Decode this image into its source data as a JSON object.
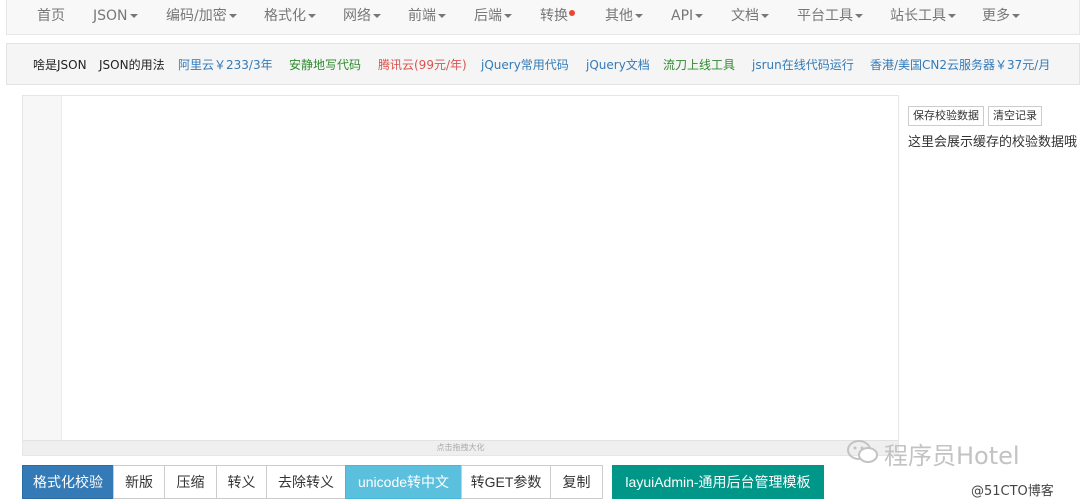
{
  "nav": {
    "items": [
      {
        "label": "首页",
        "dropdown": false
      },
      {
        "label": "JSON",
        "dropdown": true
      },
      {
        "label": "编码/加密",
        "dropdown": true
      },
      {
        "label": "格式化",
        "dropdown": true
      },
      {
        "label": "网络",
        "dropdown": true
      },
      {
        "label": "前端",
        "dropdown": true
      },
      {
        "label": "后端",
        "dropdown": true
      },
      {
        "label": "转换",
        "dropdown": false,
        "dot": true
      },
      {
        "label": "其他",
        "dropdown": true
      },
      {
        "label": "API",
        "dropdown": true
      },
      {
        "label": "文档",
        "dropdown": true
      },
      {
        "label": "平台工具",
        "dropdown": true
      },
      {
        "label": "站长工具",
        "dropdown": true
      },
      {
        "label": "更多",
        "dropdown": true
      }
    ]
  },
  "links": [
    {
      "label": "啥是JSON",
      "color": "#222222"
    },
    {
      "label": "JSON的用法",
      "color": "#222222"
    },
    {
      "label": "阿里云￥233/3年",
      "color": "#337ab7"
    },
    {
      "label": "安静地写代码",
      "color": "#2e8b2e"
    },
    {
      "label": "腾讯云(99元/年)",
      "color": "#d9534f"
    },
    {
      "label": "jQuery常用代码",
      "color": "#337ab7"
    },
    {
      "label": "jQuery文档",
      "color": "#337ab7"
    },
    {
      "label": "流刀上线工具",
      "color": "#2e8b2e"
    },
    {
      "label": "jsrun在线代码运行",
      "color": "#337ab7"
    },
    {
      "label": "香港/美国CN2云服务器￥37元/月",
      "color": "#337ab7"
    }
  ],
  "editor": {
    "resize_hint": "点击拖拽大化"
  },
  "side": {
    "save_label": "保存校验数据",
    "clear_label": "清空记录",
    "cache_text": "这里会展示缓存的校验数据哦"
  },
  "toolbar": {
    "buttons": [
      {
        "label": "格式化校验",
        "style": "primary"
      },
      {
        "label": "新版",
        "style": "default"
      },
      {
        "label": "压缩",
        "style": "default"
      },
      {
        "label": "转义",
        "style": "default"
      },
      {
        "label": "去除转义",
        "style": "default"
      },
      {
        "label": "unicode转中文",
        "style": "info"
      },
      {
        "label": "转GET参数",
        "style": "default"
      },
      {
        "label": "复制",
        "style": "default"
      }
    ],
    "extra_button": "layuiAdmin-通用后台管理模板"
  },
  "watermark": {
    "text": "程序员Hotel",
    "copyright": "@51CTO博客"
  }
}
